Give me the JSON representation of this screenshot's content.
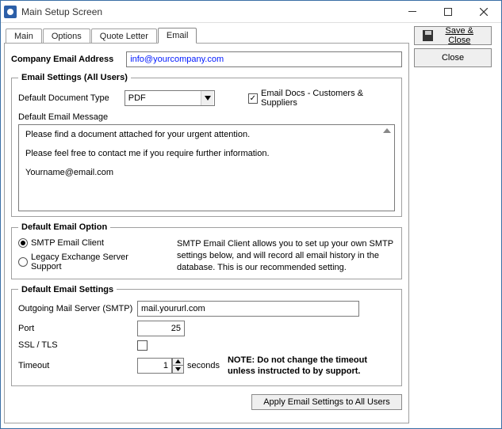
{
  "window": {
    "title": "Main Setup Screen"
  },
  "sidebar": {
    "save_close": "Save & Close",
    "close": "Close"
  },
  "tabs": {
    "main": "Main",
    "options": "Options",
    "quote_letter": "Quote Letter",
    "email": "Email"
  },
  "company_email": {
    "label": "Company Email Address",
    "value": "info@yourcompany.com"
  },
  "settings_group": {
    "legend": "Email Settings (All Users)",
    "doc_type_label": "Default Document Type",
    "doc_type_value": "PDF",
    "email_docs_label": "Email Docs - Customers & Suppliers",
    "default_msg_label": "Default Email Message",
    "msg_line1": "Please find a document attached for your urgent attention.",
    "msg_line2": "Please feel free to contact me if you require further information.",
    "msg_line3": "Yourname@email.com"
  },
  "option_group": {
    "legend": "Default Email Option",
    "smtp_label": "SMTP Email Client",
    "legacy_label": "Legacy Exchange Server Support",
    "description": "SMTP Email Client allows you to set up your own SMTP settings below, and will record all email history in the database.  This is our recommended setting."
  },
  "smtp_group": {
    "legend": "Default Email Settings",
    "server_label": "Outgoing Mail Server (SMTP)",
    "server_value": "mail.yoururl.com",
    "port_label": "Port",
    "port_value": "25",
    "ssl_label": "SSL / TLS",
    "timeout_label": "Timeout",
    "timeout_value": "1",
    "seconds_label": "seconds",
    "note": "NOTE: Do not change the timeout unless instructed to by support."
  },
  "apply_button": "Apply Email Settings to All Users"
}
